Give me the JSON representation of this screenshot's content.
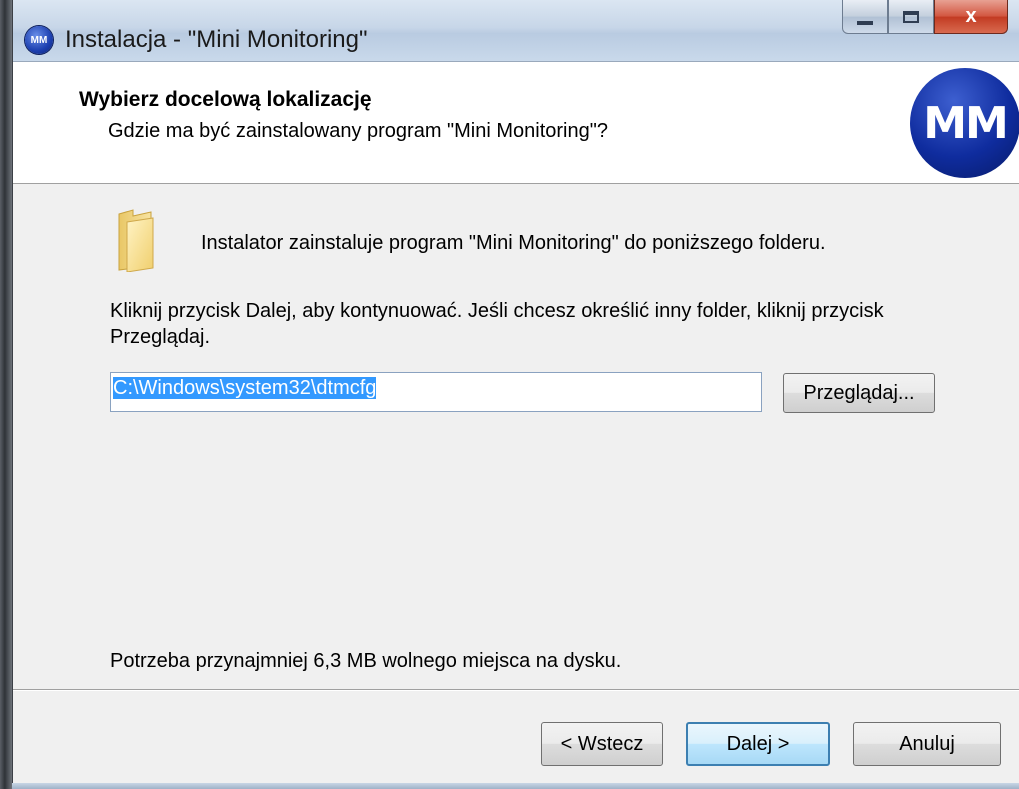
{
  "window": {
    "title": "Instalacja - \"Mini Monitoring\"",
    "icon_label": "MM",
    "close_glyph": "x"
  },
  "header": {
    "title": "Wybierz docelową lokalizację",
    "subtitle": "Gdzie ma być zainstalowany program \"Mini Monitoring\"?",
    "logo_text": "MM"
  },
  "content": {
    "intro": "Instalator zainstaluje program \"Mini Monitoring\" do poniższego folderu.",
    "instruction": "Kliknij przycisk Dalej, aby kontynuować. Jeśli chcesz określić inny folder, kliknij przycisk Przeglądaj.",
    "install_path": "C:\\Windows\\system32\\dtmcfg",
    "browse_label": "Przeglądaj...",
    "space_required": "Potrzeba przynajmniej 6,3 MB wolnego miejsca na dysku."
  },
  "footer": {
    "back_label": "< Wstecz",
    "next_label": "Dalej >",
    "cancel_label": "Anuluj"
  },
  "colors": {
    "selection": "#3399ff",
    "logo_blue": "#0f2c9e",
    "default_button_border": "#3c7fb1"
  },
  "icons": {
    "app": "mini-monitoring-logo",
    "folder": "folder-icon"
  }
}
